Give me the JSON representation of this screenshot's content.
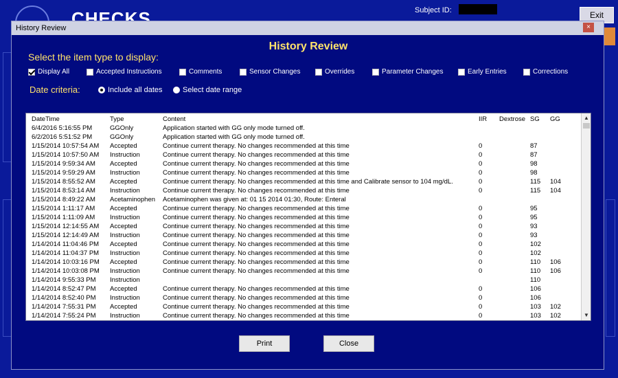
{
  "background": {
    "app_title": "CHECKS",
    "subject_label": "Subject ID:",
    "exit_label": "Exit"
  },
  "dialog": {
    "window_title": "History Review",
    "heading": "History Review",
    "close_glyph": "×",
    "select_label": "Select the item type to display:",
    "item_types": [
      {
        "label": "Display All",
        "checked": true
      },
      {
        "label": "Accepted Instructions",
        "checked": false
      },
      {
        "label": "Comments",
        "checked": false
      },
      {
        "label": "Sensor Changes",
        "checked": false
      },
      {
        "label": "Overrides",
        "checked": false
      },
      {
        "label": "Parameter Changes",
        "checked": false
      },
      {
        "label": "Early Entries",
        "checked": false
      },
      {
        "label": "Corrections",
        "checked": false
      }
    ],
    "date_criteria_label": "Date criteria:",
    "date_options": [
      {
        "label": "Include all dates",
        "selected": true
      },
      {
        "label": "Select date range",
        "selected": false
      }
    ],
    "print_label": "Print",
    "close_label": "Close"
  },
  "table": {
    "headers": [
      "DateTime",
      "Type",
      "Content",
      "IIR",
      "Dextrose",
      "SG",
      "GG"
    ],
    "rows": [
      [
        "6/4/2016 5:16:55 PM",
        "GGOnly",
        "Application started with GG only mode turned off.",
        "",
        "",
        "",
        ""
      ],
      [
        "6/2/2016 5:51:52 PM",
        "GGOnly",
        "Application started with GG only mode turned off.",
        "",
        "",
        "",
        ""
      ],
      [
        "1/15/2014 10:57:54 AM",
        "Accepted",
        "Continue current therapy. No changes recommended at this time",
        "0",
        "",
        "87",
        ""
      ],
      [
        "1/15/2014 10:57:50 AM",
        "Instruction",
        "Continue current therapy. No changes recommended at this time",
        "0",
        "",
        "87",
        ""
      ],
      [
        "1/15/2014 9:59:34 AM",
        "Accepted",
        "Continue current therapy. No changes recommended at this time",
        "0",
        "",
        "98",
        ""
      ],
      [
        "1/15/2014 9:59:29 AM",
        "Instruction",
        "Continue current therapy. No changes recommended at this time",
        "0",
        "",
        "98",
        ""
      ],
      [
        "1/15/2014 8:55:52 AM",
        "Accepted",
        "Continue current therapy. No changes recommended at this time and Calibrate sensor to 104 mg/dL.",
        "0",
        "",
        "115",
        "104"
      ],
      [
        "1/15/2014 8:53:14 AM",
        "Instruction",
        "Continue current therapy. No changes recommended at this time",
        "0",
        "",
        "115",
        "104"
      ],
      [
        "1/15/2014 8:49:22 AM",
        "Acetaminophen",
        "Acetaminophen was given at: 01 15 2014 01:30, Route: Enteral",
        "",
        "",
        "",
        ""
      ],
      [
        "1/15/2014 1:11:17 AM",
        "Accepted",
        "Continue current therapy. No changes recommended at this time",
        "0",
        "",
        "95",
        ""
      ],
      [
        "1/15/2014 1:11:09 AM",
        "Instruction",
        "Continue current therapy. No changes recommended at this time",
        "0",
        "",
        "95",
        ""
      ],
      [
        "1/15/2014 12:14:55 AM",
        "Accepted",
        "Continue current therapy. No changes recommended at this time",
        "0",
        "",
        "93",
        ""
      ],
      [
        "1/15/2014 12:14:49 AM",
        "Instruction",
        "Continue current therapy. No changes recommended at this time",
        "0",
        "",
        "93",
        ""
      ],
      [
        "1/14/2014 11:04:46 PM",
        "Accepted",
        "Continue current therapy. No changes recommended at this time",
        "0",
        "",
        "102",
        ""
      ],
      [
        "1/14/2014 11:04:37 PM",
        "Instruction",
        "Continue current therapy. No changes recommended at this time",
        "0",
        "",
        "102",
        ""
      ],
      [
        "1/14/2014 10:03:16 PM",
        "Accepted",
        "Continue current therapy. No changes recommended at this time",
        "0",
        "",
        "110",
        "106"
      ],
      [
        "1/14/2014 10:03:08 PM",
        "Instruction",
        "Continue current therapy. No changes recommended at this time",
        "0",
        "",
        "110",
        "106"
      ],
      [
        "1/14/2014 9:55:33 PM",
        "Instruction",
        "",
        "",
        "",
        "110",
        ""
      ],
      [
        "1/14/2014 8:52:47 PM",
        "Accepted",
        "Continue current therapy. No changes recommended at this time",
        "0",
        "",
        "106",
        ""
      ],
      [
        "1/14/2014 8:52:40 PM",
        "Instruction",
        "Continue current therapy. No changes recommended at this time",
        "0",
        "",
        "106",
        ""
      ],
      [
        "1/14/2014 7:55:31 PM",
        "Accepted",
        "Continue current therapy. No changes recommended at this time",
        "0",
        "",
        "103",
        "102"
      ],
      [
        "1/14/2014 7:55:24 PM",
        "Instruction",
        "Continue current therapy. No changes recommended at this time",
        "0",
        "",
        "103",
        "102"
      ]
    ]
  },
  "scrollbar": {
    "up_glyph": "▲",
    "down_glyph": "▼"
  }
}
